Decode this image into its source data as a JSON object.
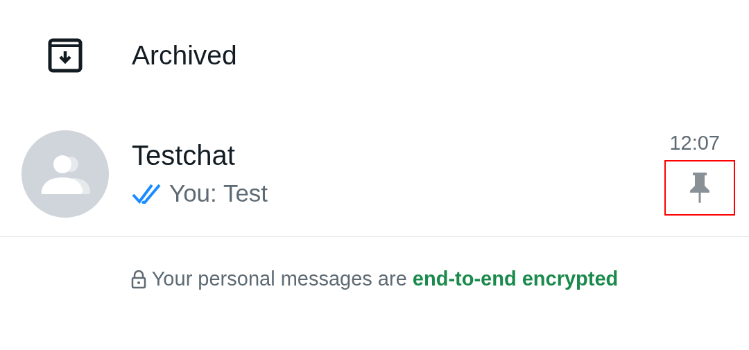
{
  "archived": {
    "label": "Archived"
  },
  "chats": [
    {
      "name": "Testchat",
      "preview": "You: Test",
      "time": "12:07",
      "read": true,
      "pinned": true,
      "pin_highlighted": true
    }
  ],
  "footer": {
    "text": "Your personal messages are **end-to-end encrypted**"
  }
}
